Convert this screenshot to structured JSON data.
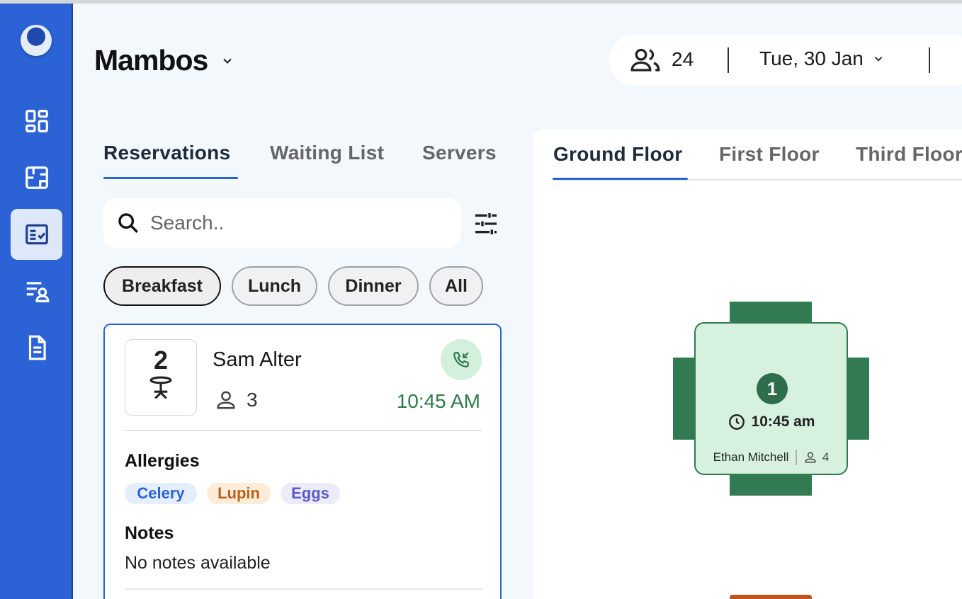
{
  "app": {
    "venue_name": "Mambos"
  },
  "header": {
    "guest_count": "24",
    "date": "Tue, 30 Jan"
  },
  "sidebar": {
    "items": [
      {
        "name": "dashboard-icon",
        "active": false
      },
      {
        "name": "floor-plan-icon",
        "active": false
      },
      {
        "name": "reservations-icon",
        "active": true
      },
      {
        "name": "guest-list-icon",
        "active": false
      },
      {
        "name": "document-icon",
        "active": false
      }
    ]
  },
  "left_tabs": [
    {
      "label": "Reservations",
      "active": true
    },
    {
      "label": "Waiting List",
      "active": false
    },
    {
      "label": "Servers",
      "active": false
    }
  ],
  "search": {
    "placeholder": "Search.."
  },
  "meal_filters": [
    {
      "label": "Breakfast",
      "active": true
    },
    {
      "label": "Lunch",
      "active": false
    },
    {
      "label": "Dinner",
      "active": false
    },
    {
      "label": "All",
      "active": false
    }
  ],
  "reservation": {
    "table_number": "2",
    "guest_name": "Sam Alter",
    "party_size": "3",
    "time": "10:45 AM",
    "allergies_title": "Allergies",
    "allergies": [
      {
        "label": "Celery",
        "color": "#2b63d6",
        "bg": "#e4eefc"
      },
      {
        "label": "Lupin",
        "color": "#b8621b",
        "bg": "#fcecd8"
      },
      {
        "label": "Eggs",
        "color": "#5a5ac8",
        "bg": "#ebebfa"
      }
    ],
    "notes_title": "Notes",
    "notes": "No notes available"
  },
  "floor_tabs": [
    {
      "label": "Ground Floor",
      "active": true
    },
    {
      "label": "First Floor",
      "active": false
    },
    {
      "label": "Third Floor",
      "active": false
    }
  ],
  "floor_table": {
    "number": "1",
    "time": "10:45 am",
    "guest_name": "Ethan Mitchell",
    "party_size": "4",
    "status_color": "#327b52"
  },
  "colors": {
    "sidebar": "#2b63d6",
    "accent": "#2b63d6",
    "success": "#2f7a4a"
  }
}
